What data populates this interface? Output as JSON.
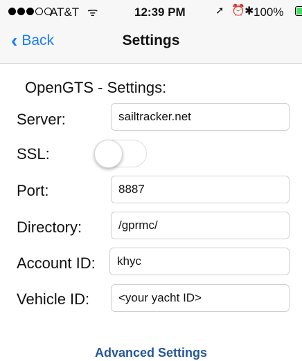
{
  "status_bar": {
    "carrier": "AT&T",
    "time": "12:39 PM",
    "battery_percent": "100%",
    "signal_bars": 3,
    "signal_max": 5,
    "battery_level": 1.0,
    "battery_color": "#4cd964",
    "wifi_glyph": "ᯤ",
    "location_glyph": "➚",
    "alarm_glyph": "⏰",
    "bluetooth_glyph": "✱"
  },
  "nav": {
    "back_label": "Back",
    "back_glyph": "‹",
    "title": "Settings"
  },
  "form": {
    "section_title": "OpenGTS - Settings:",
    "server": {
      "label": "Server:",
      "value": "sailtracker.net"
    },
    "ssl": {
      "label": "SSL:",
      "enabled": false
    },
    "port": {
      "label": "Port:",
      "value": "8887"
    },
    "directory": {
      "label": "Directory:",
      "value": "/gprmc/"
    },
    "account": {
      "label": "Account ID:",
      "value": "khyc"
    },
    "vehicle": {
      "label": "Vehicle ID:",
      "value": "<your yacht ID>"
    }
  },
  "advanced_label": "Advanced Settings",
  "colors": {
    "accent": "#147efb",
    "advanced_link": "#23579c"
  }
}
